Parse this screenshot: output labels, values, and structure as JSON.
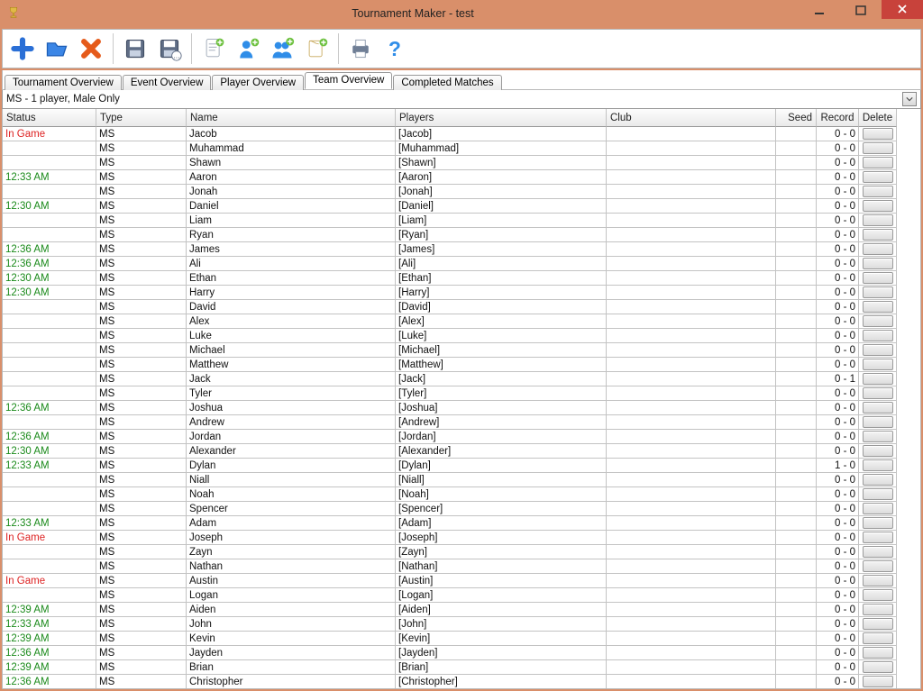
{
  "window": {
    "title": "Tournament Maker - test"
  },
  "tabs": [
    {
      "label": "Tournament Overview"
    },
    {
      "label": "Event Overview"
    },
    {
      "label": "Player Overview"
    },
    {
      "label": "Team Overview",
      "active": true
    },
    {
      "label": "Completed Matches"
    }
  ],
  "filter": {
    "text": "MS - 1 player, Male Only"
  },
  "columns": {
    "status": "Status",
    "type": "Type",
    "name": "Name",
    "players": "Players",
    "club": "Club",
    "seed": "Seed",
    "record": "Record",
    "delete": "Delete"
  },
  "rows": [
    {
      "status": "In Game",
      "status_kind": "ingame",
      "type": "MS",
      "name": "Jacob",
      "players": "[Jacob]",
      "club": "",
      "seed": "",
      "record": "0 - 0"
    },
    {
      "status": "",
      "status_kind": "",
      "type": "MS",
      "name": "Muhammad",
      "players": "[Muhammad]",
      "club": "",
      "seed": "",
      "record": "0 - 0"
    },
    {
      "status": "",
      "status_kind": "",
      "type": "MS",
      "name": "Shawn",
      "players": "[Shawn]",
      "club": "",
      "seed": "",
      "record": "0 - 0"
    },
    {
      "status": "12:33 AM",
      "status_kind": "time",
      "type": "MS",
      "name": "Aaron",
      "players": "[Aaron]",
      "club": "",
      "seed": "",
      "record": "0 - 0"
    },
    {
      "status": "",
      "status_kind": "",
      "type": "MS",
      "name": "Jonah",
      "players": "[Jonah]",
      "club": "",
      "seed": "",
      "record": "0 - 0"
    },
    {
      "status": "12:30 AM",
      "status_kind": "time",
      "type": "MS",
      "name": "Daniel",
      "players": "[Daniel]",
      "club": "",
      "seed": "",
      "record": "0 - 0"
    },
    {
      "status": "",
      "status_kind": "",
      "type": "MS",
      "name": "Liam",
      "players": "[Liam]",
      "club": "",
      "seed": "",
      "record": "0 - 0"
    },
    {
      "status": "",
      "status_kind": "",
      "type": "MS",
      "name": "Ryan",
      "players": "[Ryan]",
      "club": "",
      "seed": "",
      "record": "0 - 0"
    },
    {
      "status": "12:36 AM",
      "status_kind": "time",
      "type": "MS",
      "name": "James",
      "players": "[James]",
      "club": "",
      "seed": "",
      "record": "0 - 0"
    },
    {
      "status": "12:36 AM",
      "status_kind": "time",
      "type": "MS",
      "name": "Ali",
      "players": "[Ali]",
      "club": "",
      "seed": "",
      "record": "0 - 0"
    },
    {
      "status": "12:30 AM",
      "status_kind": "time",
      "type": "MS",
      "name": "Ethan",
      "players": "[Ethan]",
      "club": "",
      "seed": "",
      "record": "0 - 0"
    },
    {
      "status": "12:30 AM",
      "status_kind": "time",
      "type": "MS",
      "name": "Harry",
      "players": "[Harry]",
      "club": "",
      "seed": "",
      "record": "0 - 0"
    },
    {
      "status": "",
      "status_kind": "",
      "type": "MS",
      "name": "David",
      "players": "[David]",
      "club": "",
      "seed": "",
      "record": "0 - 0"
    },
    {
      "status": "",
      "status_kind": "",
      "type": "MS",
      "name": "Alex",
      "players": "[Alex]",
      "club": "",
      "seed": "",
      "record": "0 - 0"
    },
    {
      "status": "",
      "status_kind": "",
      "type": "MS",
      "name": "Luke",
      "players": "[Luke]",
      "club": "",
      "seed": "",
      "record": "0 - 0"
    },
    {
      "status": "",
      "status_kind": "",
      "type": "MS",
      "name": "Michael",
      "players": "[Michael]",
      "club": "",
      "seed": "",
      "record": "0 - 0"
    },
    {
      "status": "",
      "status_kind": "",
      "type": "MS",
      "name": "Matthew",
      "players": "[Matthew]",
      "club": "",
      "seed": "",
      "record": "0 - 0"
    },
    {
      "status": "",
      "status_kind": "",
      "type": "MS",
      "name": "Jack",
      "players": "[Jack]",
      "club": "",
      "seed": "",
      "record": "0 - 1"
    },
    {
      "status": "",
      "status_kind": "",
      "type": "MS",
      "name": "Tyler",
      "players": "[Tyler]",
      "club": "",
      "seed": "",
      "record": "0 - 0"
    },
    {
      "status": "12:36 AM",
      "status_kind": "time",
      "type": "MS",
      "name": "Joshua",
      "players": "[Joshua]",
      "club": "",
      "seed": "",
      "record": "0 - 0"
    },
    {
      "status": "",
      "status_kind": "",
      "type": "MS",
      "name": "Andrew",
      "players": "[Andrew]",
      "club": "",
      "seed": "",
      "record": "0 - 0"
    },
    {
      "status": "12:36 AM",
      "status_kind": "time",
      "type": "MS",
      "name": "Jordan",
      "players": "[Jordan]",
      "club": "",
      "seed": "",
      "record": "0 - 0"
    },
    {
      "status": "12:30 AM",
      "status_kind": "time",
      "type": "MS",
      "name": "Alexander",
      "players": "[Alexander]",
      "club": "",
      "seed": "",
      "record": "0 - 0"
    },
    {
      "status": "12:33 AM",
      "status_kind": "time",
      "type": "MS",
      "name": "Dylan",
      "players": "[Dylan]",
      "club": "",
      "seed": "",
      "record": "1 - 0"
    },
    {
      "status": "",
      "status_kind": "",
      "type": "MS",
      "name": "Niall",
      "players": "[Niall]",
      "club": "",
      "seed": "",
      "record": "0 - 0"
    },
    {
      "status": "",
      "status_kind": "",
      "type": "MS",
      "name": "Noah",
      "players": "[Noah]",
      "club": "",
      "seed": "",
      "record": "0 - 0"
    },
    {
      "status": "",
      "status_kind": "",
      "type": "MS",
      "name": "Spencer",
      "players": "[Spencer]",
      "club": "",
      "seed": "",
      "record": "0 - 0"
    },
    {
      "status": "12:33 AM",
      "status_kind": "time",
      "type": "MS",
      "name": "Adam",
      "players": "[Adam]",
      "club": "",
      "seed": "",
      "record": "0 - 0"
    },
    {
      "status": "In Game",
      "status_kind": "ingame",
      "type": "MS",
      "name": "Joseph",
      "players": "[Joseph]",
      "club": "",
      "seed": "",
      "record": "0 - 0"
    },
    {
      "status": "",
      "status_kind": "",
      "type": "MS",
      "name": "Zayn",
      "players": "[Zayn]",
      "club": "",
      "seed": "",
      "record": "0 - 0"
    },
    {
      "status": "",
      "status_kind": "",
      "type": "MS",
      "name": "Nathan",
      "players": "[Nathan]",
      "club": "",
      "seed": "",
      "record": "0 - 0"
    },
    {
      "status": "In Game",
      "status_kind": "ingame",
      "type": "MS",
      "name": "Austin",
      "players": "[Austin]",
      "club": "",
      "seed": "",
      "record": "0 - 0"
    },
    {
      "status": "",
      "status_kind": "",
      "type": "MS",
      "name": "Logan",
      "players": "[Logan]",
      "club": "",
      "seed": "",
      "record": "0 - 0"
    },
    {
      "status": "12:39 AM",
      "status_kind": "time",
      "type": "MS",
      "name": "Aiden",
      "players": "[Aiden]",
      "club": "",
      "seed": "",
      "record": "0 - 0"
    },
    {
      "status": "12:33 AM",
      "status_kind": "time",
      "type": "MS",
      "name": "John",
      "players": "[John]",
      "club": "",
      "seed": "",
      "record": "0 - 0"
    },
    {
      "status": "12:39 AM",
      "status_kind": "time",
      "type": "MS",
      "name": "Kevin",
      "players": "[Kevin]",
      "club": "",
      "seed": "",
      "record": "0 - 0"
    },
    {
      "status": "12:36 AM",
      "status_kind": "time",
      "type": "MS",
      "name": "Jayden",
      "players": "[Jayden]",
      "club": "",
      "seed": "",
      "record": "0 - 0"
    },
    {
      "status": "12:39 AM",
      "status_kind": "time",
      "type": "MS",
      "name": "Brian",
      "players": "[Brian]",
      "club": "",
      "seed": "",
      "record": "0 - 0"
    },
    {
      "status": "12:36 AM",
      "status_kind": "time",
      "type": "MS",
      "name": "Christopher",
      "players": "[Christopher]",
      "club": "",
      "seed": "",
      "record": "0 - 0"
    }
  ]
}
